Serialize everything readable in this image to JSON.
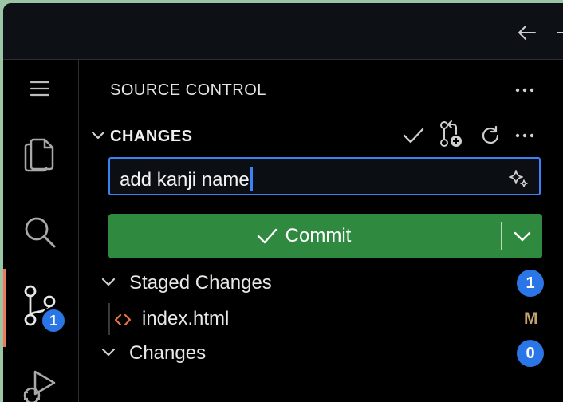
{
  "panel": {
    "title": "SOURCE CONTROL"
  },
  "changes_section": {
    "title": "CHANGES"
  },
  "commit": {
    "message": "add kanji name",
    "button_label": "Commit"
  },
  "staged": {
    "label": "Staged Changes",
    "count": "1",
    "files": [
      {
        "name": "index.html",
        "status": "M",
        "icon": "html-code-icon"
      }
    ]
  },
  "unstaged": {
    "label": "Changes",
    "count": "0"
  },
  "activity": {
    "scm_badge": "1",
    "items": [
      "menu-icon",
      "explorer-icon",
      "search-icon",
      "source-control-icon",
      "run-debug-icon"
    ]
  },
  "colors": {
    "accent": "#3b82f6",
    "commit_green": "#2f8a3f",
    "badge_blue": "#2a76e6",
    "active_indicator": "#f0795b",
    "modified": "#c5a371",
    "html_icon": "#e8773f"
  }
}
